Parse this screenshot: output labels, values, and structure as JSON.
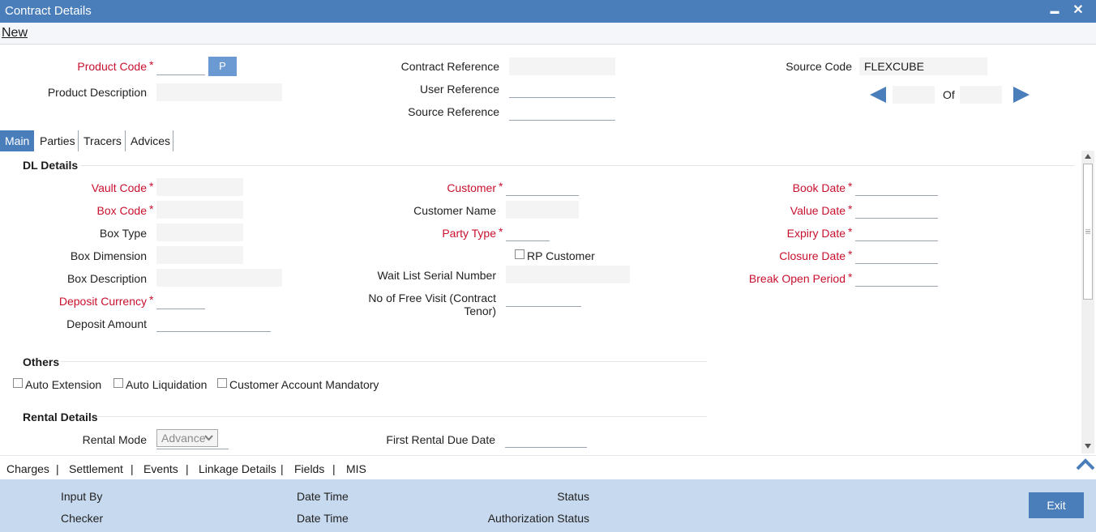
{
  "window": {
    "title": "Contract Details",
    "minimize": "▬",
    "close": "✕"
  },
  "menu": {
    "new_label": "New"
  },
  "header": {
    "product_code_label": "Product Code",
    "p_button": "P",
    "product_description_label": "Product Description",
    "contract_reference_label": "Contract Reference",
    "user_reference_label": "User Reference",
    "source_reference_label": "Source Reference",
    "source_code_label": "Source Code",
    "source_code_value": "FLEXCUBE",
    "of_label": "Of",
    "required_marker": "*"
  },
  "tabs": [
    "Main",
    "Parties",
    "Tracers",
    "Advices"
  ],
  "dl_details": {
    "title": "DL Details",
    "vault_code": "Vault Code",
    "box_code": "Box Code",
    "box_type": "Box Type",
    "box_dimension": "Box Dimension",
    "box_description": "Box Description",
    "deposit_currency": "Deposit Currency",
    "deposit_amount": "Deposit Amount",
    "customer": "Customer",
    "customer_name": "Customer Name",
    "party_type": "Party Type",
    "rp_customer": "RP Customer",
    "wait_list_serial_number": "Wait List Serial Number",
    "no_of_free_visit_line1": "No of Free Visit (Contract",
    "no_of_free_visit_line2": "Tenor)",
    "book_date": "Book Date",
    "value_date": "Value Date",
    "expiry_date": "Expiry Date",
    "closure_date": "Closure Date",
    "break_open_period": "Break Open Period"
  },
  "others": {
    "title": "Others",
    "auto_extension": "Auto Extension",
    "auto_liquidation": "Auto Liquidation",
    "customer_account_mandatory": "Customer Account Mandatory"
  },
  "rental": {
    "title": "Rental Details",
    "rental_mode_label": "Rental Mode",
    "rental_mode_value": "Advance",
    "first_rental_due_date": "First Rental Due Date"
  },
  "bottom_links": [
    "Charges",
    "Settlement",
    "Events",
    "Linkage Details",
    "Fields",
    "MIS"
  ],
  "footer": {
    "input_by": "Input By",
    "checker": "Checker",
    "date_time_1": "Date Time",
    "date_time_2": "Date Time",
    "status": "Status",
    "authorization_status": "Authorization Status",
    "exit": "Exit"
  },
  "colors": {
    "accent": "#4a7ebb",
    "required": "#c8102e",
    "footer": "#c7d9ee"
  }
}
